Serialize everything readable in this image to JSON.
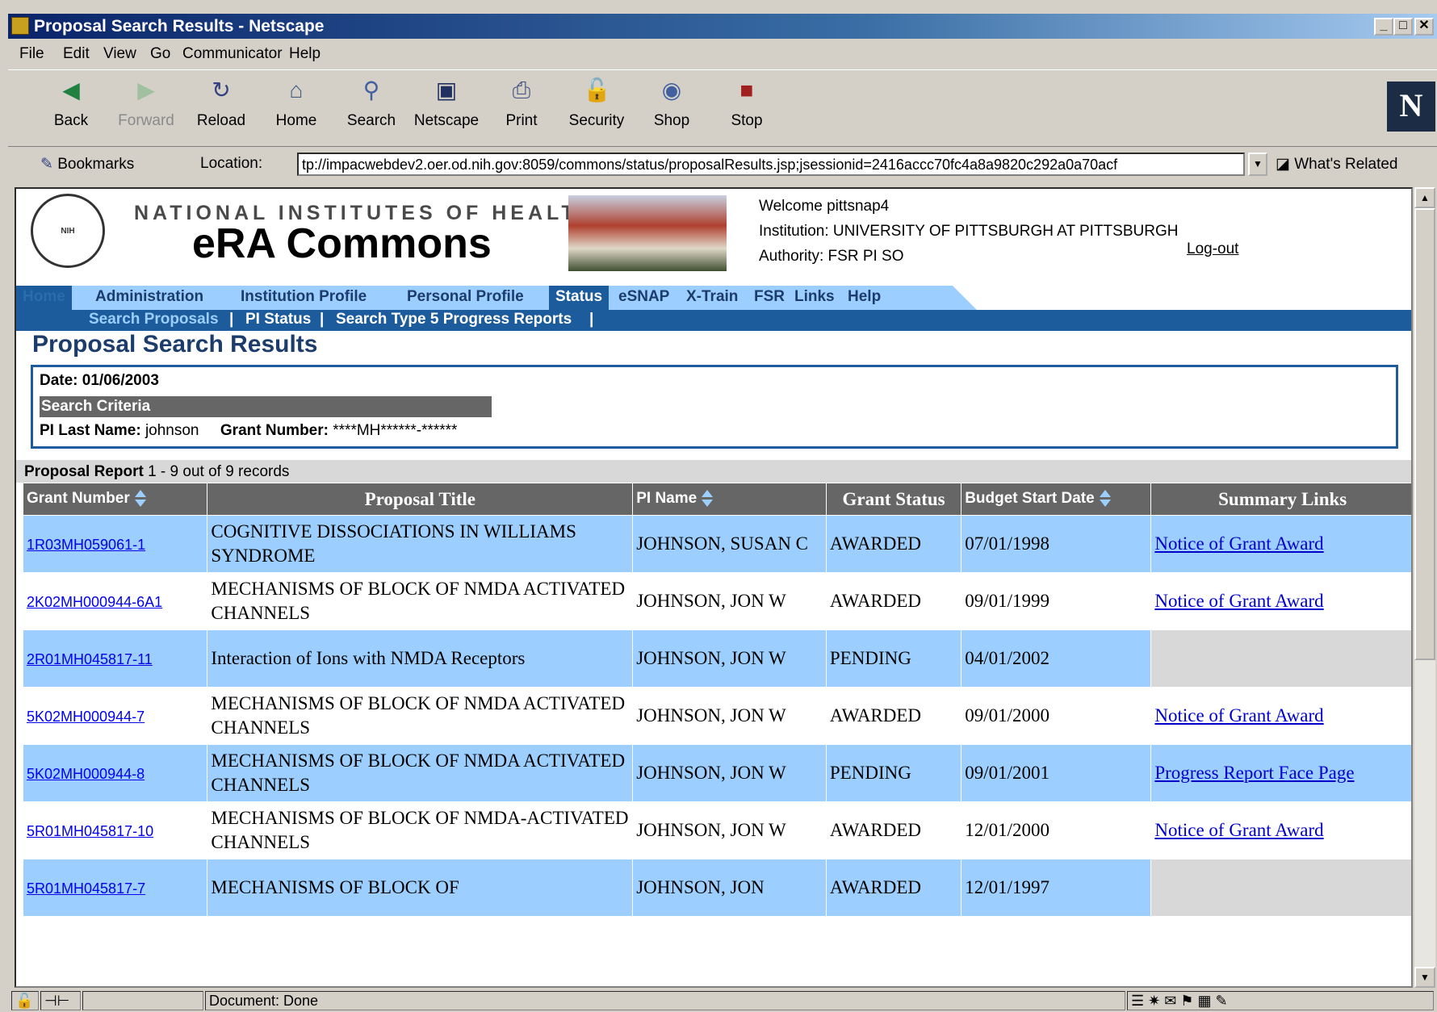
{
  "window": {
    "title": "Proposal Search Results - Netscape"
  },
  "menu": [
    "File",
    "Edit",
    "View",
    "Go",
    "Communicator",
    "Help"
  ],
  "toolbar": [
    {
      "label": "Back",
      "icon": "back-arrow-icon",
      "enabled": true
    },
    {
      "label": "Forward",
      "icon": "forward-arrow-icon",
      "enabled": false
    },
    {
      "label": "Reload",
      "icon": "reload-icon",
      "enabled": true
    },
    {
      "label": "Home",
      "icon": "home-icon",
      "enabled": true
    },
    {
      "label": "Search",
      "icon": "search-icon",
      "enabled": true
    },
    {
      "label": "Netscape",
      "icon": "my-netscape-icon",
      "enabled": true
    },
    {
      "label": "Print",
      "icon": "printer-icon",
      "enabled": true
    },
    {
      "label": "Security",
      "icon": "lock-icon",
      "enabled": true
    },
    {
      "label": "Shop",
      "icon": "shop-icon",
      "enabled": true
    },
    {
      "label": "Stop",
      "icon": "stop-icon",
      "enabled": true
    }
  ],
  "location": {
    "bookmarks_label": "Bookmarks",
    "location_label": "Location:",
    "url": "tp://impacwebdev2.oer.od.nih.gov:8059/commons/status/proposalResults.jsp;jsessionid=2416accc70fc4a8a9820c292a0a70acf",
    "whats_related": "What's Related"
  },
  "header": {
    "nih": "NATIONAL INSTITUTES OF HEALTH",
    "era": "eRA Commons",
    "welcome": "Welcome  pittsnap4",
    "institution": "Institution: UNIVERSITY OF PITTSBURGH AT PITTSBURGH",
    "authority": "Authority:   FSR  PI  SO",
    "logout": "Log-out"
  },
  "nav": [
    "Home",
    "Administration",
    "Institution Profile",
    "Personal Profile",
    "Status",
    "eSNAP",
    "X-Train",
    "FSR",
    "Links",
    "Help"
  ],
  "subnav": [
    "Search Proposals",
    "PI Status",
    "Search Type 5 Progress Reports"
  ],
  "page_title": "Proposal Search Results",
  "criteria": {
    "date": "Date: 01/06/2003",
    "heading": "Search Criteria",
    "pi_label": "PI Last Name:",
    "pi_value": "johnson",
    "grant_label": "Grant Number:",
    "grant_value": "****MH******-******"
  },
  "report": {
    "caption_bold": "Proposal Report",
    "caption_rest": " 1 - 9 out of 9 records",
    "columns": [
      "Grant Number",
      "Proposal Title",
      "PI Name",
      "Grant Status",
      "Budget Start Date",
      "Summary Links"
    ],
    "rows": [
      {
        "grant": "1R03MH059061-1",
        "title": "COGNITIVE DISSOCIATIONS IN WILLIAMS SYNDROME",
        "pi": "JOHNSON, SUSAN C",
        "status": "AWARDED",
        "start": "07/01/1998",
        "link": "Notice of Grant Award"
      },
      {
        "grant": "2K02MH000944-6A1",
        "title": "MECHANISMS OF BLOCK OF NMDA ACTIVATED CHANNELS",
        "pi": "JOHNSON, JON W",
        "status": "AWARDED",
        "start": "09/01/1999",
        "link": "Notice of Grant Award"
      },
      {
        "grant": "2R01MH045817-11",
        "title": "Interaction of Ions with NMDA Receptors",
        "pi": "JOHNSON, JON W",
        "status": "PENDING",
        "start": "04/01/2002",
        "link": ""
      },
      {
        "grant": "5K02MH000944-7",
        "title": "MECHANISMS OF BLOCK OF NMDA ACTIVATED CHANNELS",
        "pi": "JOHNSON, JON W",
        "status": "AWARDED",
        "start": "09/01/2000",
        "link": "Notice of Grant Award"
      },
      {
        "grant": "5K02MH000944-8",
        "title": "MECHANISMS OF BLOCK OF NMDA ACTIVATED CHANNELS",
        "pi": "JOHNSON, JON W",
        "status": "PENDING",
        "start": "09/01/2001",
        "link": "Progress Report Face Page"
      },
      {
        "grant": "5R01MH045817-10",
        "title": "MECHANISMS OF BLOCK OF NMDA-ACTIVATED CHANNELS",
        "pi": "JOHNSON, JON W",
        "status": "AWARDED",
        "start": "12/01/2000",
        "link": "Notice of Grant Award"
      },
      {
        "grant": "5R01MH045817-7",
        "title": "MECHANISMS OF BLOCK OF",
        "pi": "JOHNSON, JON",
        "status": "AWARDED",
        "start": "12/01/1997",
        "link": ""
      }
    ]
  },
  "status": {
    "text": "Document: Done"
  }
}
